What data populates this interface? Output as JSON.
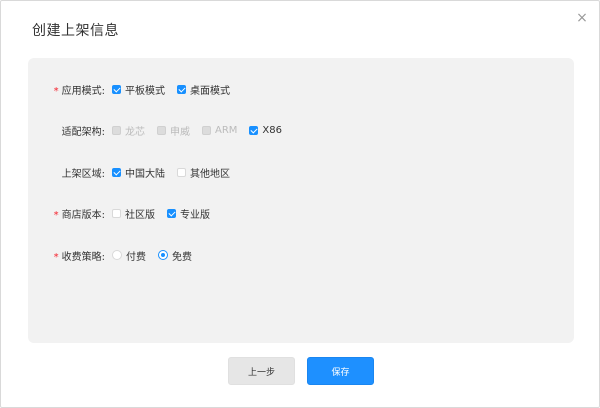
{
  "dialog": {
    "title": "创建上架信息",
    "close_label": "×"
  },
  "form": {
    "app_mode": {
      "label": "应用模式:",
      "required": true,
      "options": [
        {
          "label": "平板模式",
          "checked": true,
          "disabled": false
        },
        {
          "label": "桌面模式",
          "checked": true,
          "disabled": false
        }
      ]
    },
    "arch": {
      "label": "适配架构:",
      "required": false,
      "options": [
        {
          "label": "龙芯",
          "checked": false,
          "disabled": true
        },
        {
          "label": "申威",
          "checked": false,
          "disabled": true
        },
        {
          "label": "ARM",
          "checked": false,
          "disabled": true
        },
        {
          "label": "X86",
          "checked": true,
          "disabled": false
        }
      ]
    },
    "region": {
      "label": "上架区域:",
      "required": false,
      "options": [
        {
          "label": "中国大陆",
          "checked": true,
          "disabled": false
        },
        {
          "label": "其他地区",
          "checked": false,
          "disabled": false
        }
      ]
    },
    "store_version": {
      "label": "商店版本:",
      "required": true,
      "options": [
        {
          "label": "社区版",
          "checked": false,
          "disabled": false
        },
        {
          "label": "专业版",
          "checked": true,
          "disabled": false
        }
      ]
    },
    "pricing": {
      "label": "收费策略:",
      "required": true,
      "options": [
        {
          "label": "付费",
          "selected": false
        },
        {
          "label": "免费",
          "selected": true
        }
      ]
    },
    "required_mark": "*"
  },
  "footer": {
    "prev_label": "上一步",
    "save_label": "保存"
  },
  "colors": {
    "accent": "#1890ff",
    "required": "#f5222d",
    "panel_bg": "#f2f2f2"
  }
}
